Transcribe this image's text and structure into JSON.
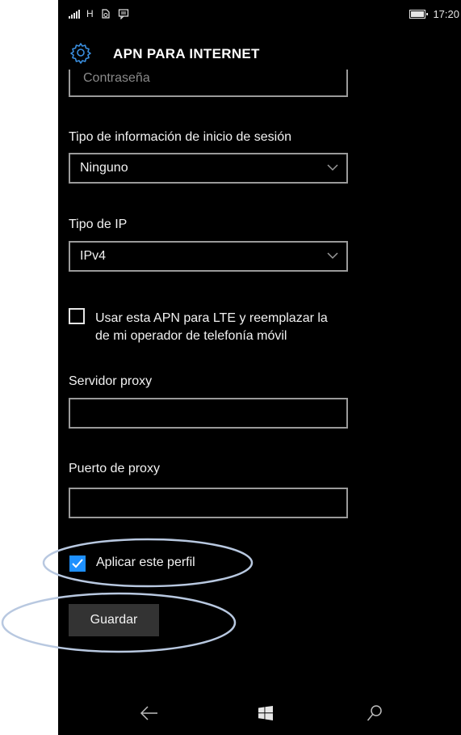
{
  "status_bar": {
    "network": "H",
    "time": "17:20"
  },
  "header": {
    "title": "APN PARA INTERNET"
  },
  "form": {
    "password_placeholder": "Contraseña",
    "login_info_type": {
      "label": "Tipo de información de inicio de sesión",
      "value": "Ninguno"
    },
    "ip_type": {
      "label": "Tipo de IP",
      "value": "IPv4"
    },
    "lte_checkbox": {
      "label": "Usar esta APN para LTE y reemplazar la de mi operador de telefonía móvil",
      "checked": false
    },
    "proxy_server": {
      "label": "Servidor proxy",
      "value": ""
    },
    "proxy_port": {
      "label": "Puerto de proxy",
      "value": ""
    },
    "apply_profile": {
      "label": "Aplicar este perfil",
      "checked": true
    },
    "save_label": "Guardar"
  },
  "nav_bar": {
    "back_icon": "back-arrow-icon",
    "start_icon": "windows-logo-icon",
    "search_icon": "search-icon"
  },
  "colors": {
    "background": "#000000",
    "accent": "#1e90ff",
    "border": "#9a9a9a",
    "annotation": "#b8c8e0"
  }
}
